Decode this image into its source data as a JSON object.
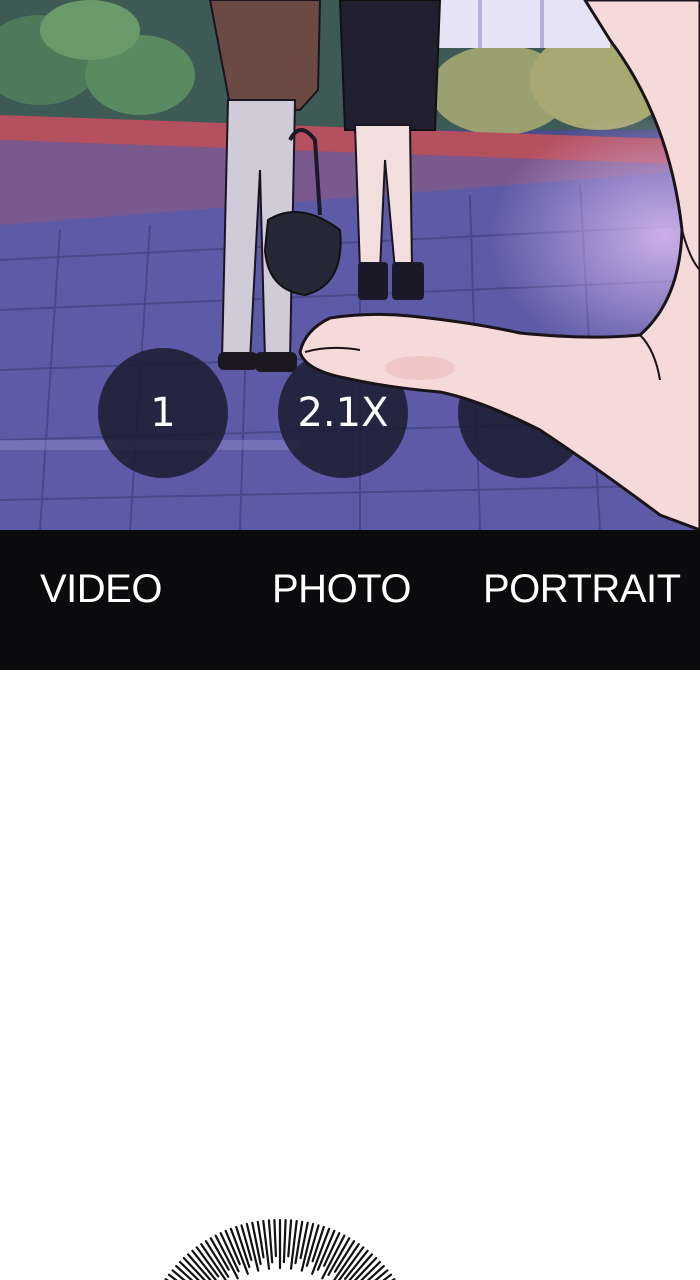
{
  "camera": {
    "zoom_buttons": [
      {
        "label": "1"
      },
      {
        "label": "2.1X"
      },
      {
        "label": ""
      }
    ],
    "modes": [
      {
        "label": "VIDEO"
      },
      {
        "label": "PHOTO"
      },
      {
        "label": "PORTRAIT"
      }
    ]
  },
  "colors": {
    "mode_bar": "#0b0b0e",
    "zoom_button": "#1c1e32",
    "text": "#ffffff",
    "skin": "#f6d9d9"
  }
}
